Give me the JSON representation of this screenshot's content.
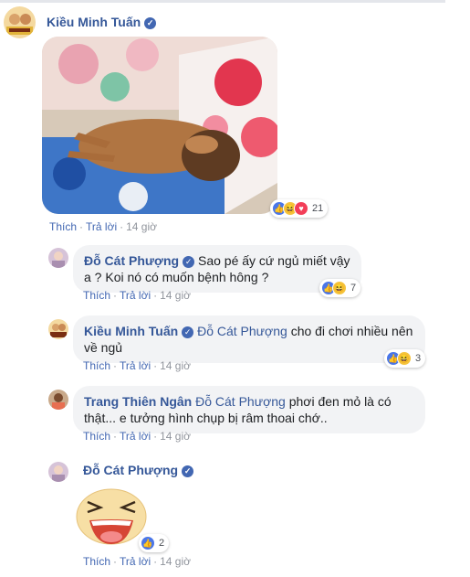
{
  "post": {
    "author": "Kiều Minh Tuấn",
    "image_alt": "Photo of a sleeping brown puppy on floral bedding",
    "actions": [
      "Thích",
      "Trả lời",
      "14 giờ"
    ],
    "reaction_count": "21",
    "reactions": [
      "like-icon",
      "haha-icon",
      "love-icon"
    ]
  },
  "replies": [
    {
      "author": "Đỗ Cát Phượng",
      "verified": true,
      "text": "Sao pé ấy cứ ngủ miết vậy a ? Koi nó có muốn bệnh hông ?",
      "actions": [
        "Thích",
        "Trả lời",
        "14 giờ"
      ],
      "reaction_count": "7",
      "reactions": [
        "like-icon",
        "haha-icon"
      ]
    },
    {
      "author": "Kiều Minh Tuấn",
      "verified": true,
      "mention": "Đỗ Cát Phượng",
      "text": "cho đi chơi nhiều nên về ngủ",
      "actions": [
        "Thích",
        "Trả lời",
        "14 giờ"
      ],
      "reaction_count": "3",
      "reactions": [
        "like-icon",
        "haha-icon"
      ]
    },
    {
      "author": "Trang Thiên Ngân",
      "verified": false,
      "mention": "Đỗ Cát Phượng",
      "text": "phơi đen mỏ là có thật... e tưởng hình chụp bị râm thoai chớ..",
      "actions": [
        "Thích",
        "Trả lời",
        "14 giờ"
      ]
    },
    {
      "author": "Đỗ Cát Phượng",
      "verified": true,
      "sticker": "laughing-sticker",
      "actions": [
        "Thích",
        "Trả lời",
        "14 giờ"
      ],
      "reaction_count": "2",
      "reactions": [
        "like-icon"
      ]
    }
  ],
  "colors": {
    "link": "#365899",
    "bubble": "#f2f3f5",
    "like": "#4a76e8",
    "love": "#f33e58",
    "haha": "#f5c33b"
  }
}
